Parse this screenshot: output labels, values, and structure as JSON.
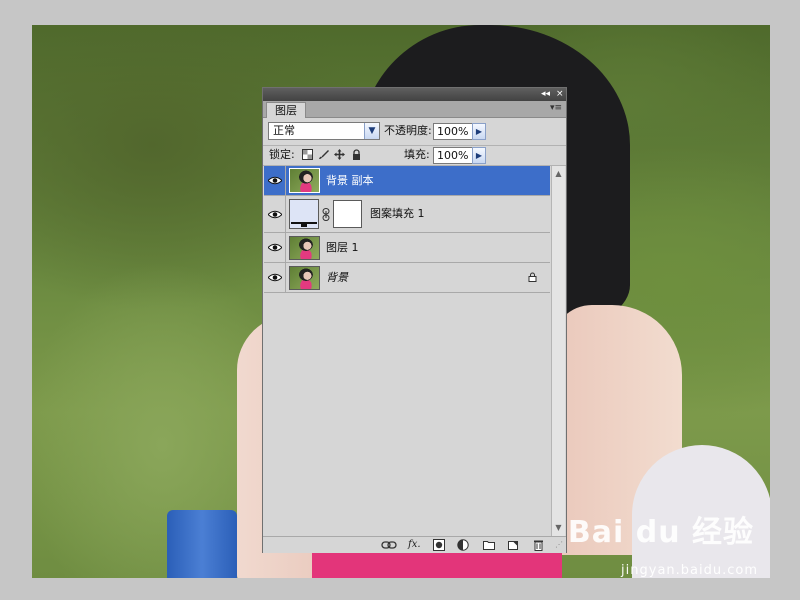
{
  "watermark": {
    "logo": "Bai du 经验",
    "url": "jingyan.baidu.com"
  },
  "panel": {
    "title_buttons": {
      "collapse": "◂◂",
      "close": "×"
    },
    "tab": "图层",
    "tab_menu": "▾≡",
    "blend_mode": "正常",
    "opacity_label": "不透明度:",
    "opacity_value": "100%",
    "lock_label": "锁定:",
    "fill_label": "填充:",
    "fill_value": "100%",
    "layers": [
      {
        "name": "背景 副本",
        "selected": true
      },
      {
        "name": "图案填充 1",
        "selected": false
      },
      {
        "name": "图层 1",
        "selected": false
      },
      {
        "name": "背景",
        "selected": false,
        "locked": true
      }
    ],
    "bottom_icons": [
      "link-icon",
      "fx-icon",
      "mask-icon",
      "adjustment-icon",
      "folder-icon",
      "new-layer-icon",
      "trash-icon"
    ],
    "fx_text": "fx."
  },
  "colors": {
    "selection": "#3d6ec9",
    "panel_bg": "#d6d6d6",
    "titlebar": "#4a4a4a"
  }
}
